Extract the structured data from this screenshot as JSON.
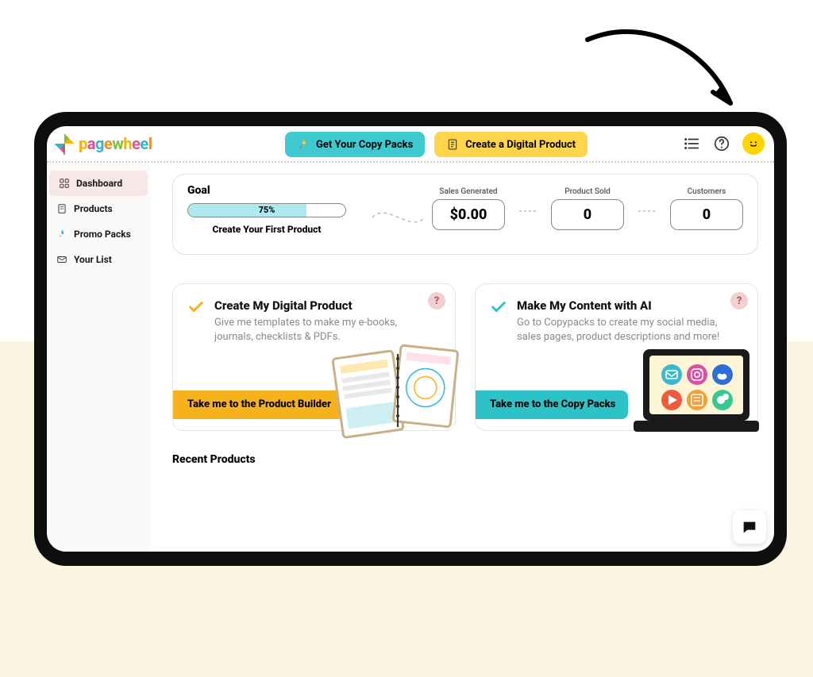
{
  "brand": "pagewheel",
  "topbar": {
    "copy_packs_btn": "Get Your Copy Packs",
    "create_product_btn": "Create a Digital Product"
  },
  "sidebar": {
    "items": [
      {
        "label": "Dashboard",
        "active": true
      },
      {
        "label": "Products",
        "active": false
      },
      {
        "label": "Promo Packs",
        "active": false
      },
      {
        "label": "Your List",
        "active": false
      }
    ]
  },
  "goal": {
    "title": "Goal",
    "progress_pct": 75,
    "progress_label": "75%",
    "subtitle": "Create Your First Product",
    "metrics": [
      {
        "label": "Sales Generated",
        "value": "$0.00"
      },
      {
        "label": "Product Sold",
        "value": "0"
      },
      {
        "label": "Customers",
        "value": "0"
      }
    ]
  },
  "cards": [
    {
      "title": "Create My Digital Product",
      "desc": "Give me templates to make my e-books, journals, checklists & PDFs.",
      "cta": "Take me to the Product Builder",
      "check_color": "#f6b21b"
    },
    {
      "title": "Make My Content with AI",
      "desc": "Go to Copypacks to create my social media, sales pages, product descriptions and more!",
      "cta": "Take me to the Copy Packs",
      "check_color": "#2cc2c7"
    }
  ],
  "recent_title": "Recent Products"
}
